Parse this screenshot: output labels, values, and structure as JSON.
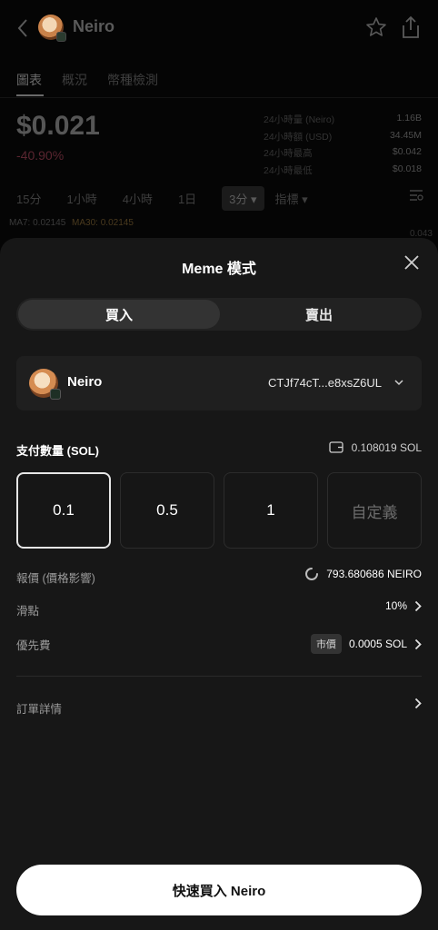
{
  "header": {
    "title": "Neiro",
    "tabs": [
      "圖表",
      "概況",
      "幣種檢測"
    ]
  },
  "market": {
    "price": "$0.021",
    "change": "-40.90%",
    "stats": [
      {
        "label": "24小時量 (Neiro)",
        "value": "1.16B"
      },
      {
        "label": "24小時額 (USD)",
        "value": "34.45M"
      },
      {
        "label": "24小時最高",
        "value": "$0.042"
      },
      {
        "label": "24小時最低",
        "value": "$0.018"
      }
    ],
    "intervals": [
      "15分",
      "1小時",
      "4小時",
      "1日"
    ],
    "selected_interval": "3分 ▾",
    "indicator": "指標 ▾",
    "ma7": "MA7: 0.02145",
    "ma30": "MA30: 0.02145",
    "axis_value": "0.043"
  },
  "sheet": {
    "title": "Meme 模式",
    "buy_label": "買入",
    "sell_label": "賣出",
    "token": {
      "name": "Neiro",
      "address": "CTJf74cT...e8xsZ6UL"
    },
    "pay_label": "支付數量 (SOL)",
    "balance": "0.108019 SOL",
    "amounts": [
      "0.1",
      "0.5",
      "1"
    ],
    "custom_label": "自定義",
    "quote_label": "報價 (價格影響)",
    "quote_value": "793.680686 NEIRO",
    "slippage_label": "滑點",
    "slippage_value": "10%",
    "priority_label": "優先費",
    "priority_pill": "市價",
    "priority_value": "0.0005 SOL",
    "order_details_label": "訂單詳情",
    "cta_label": "快速買入 Neiro"
  }
}
